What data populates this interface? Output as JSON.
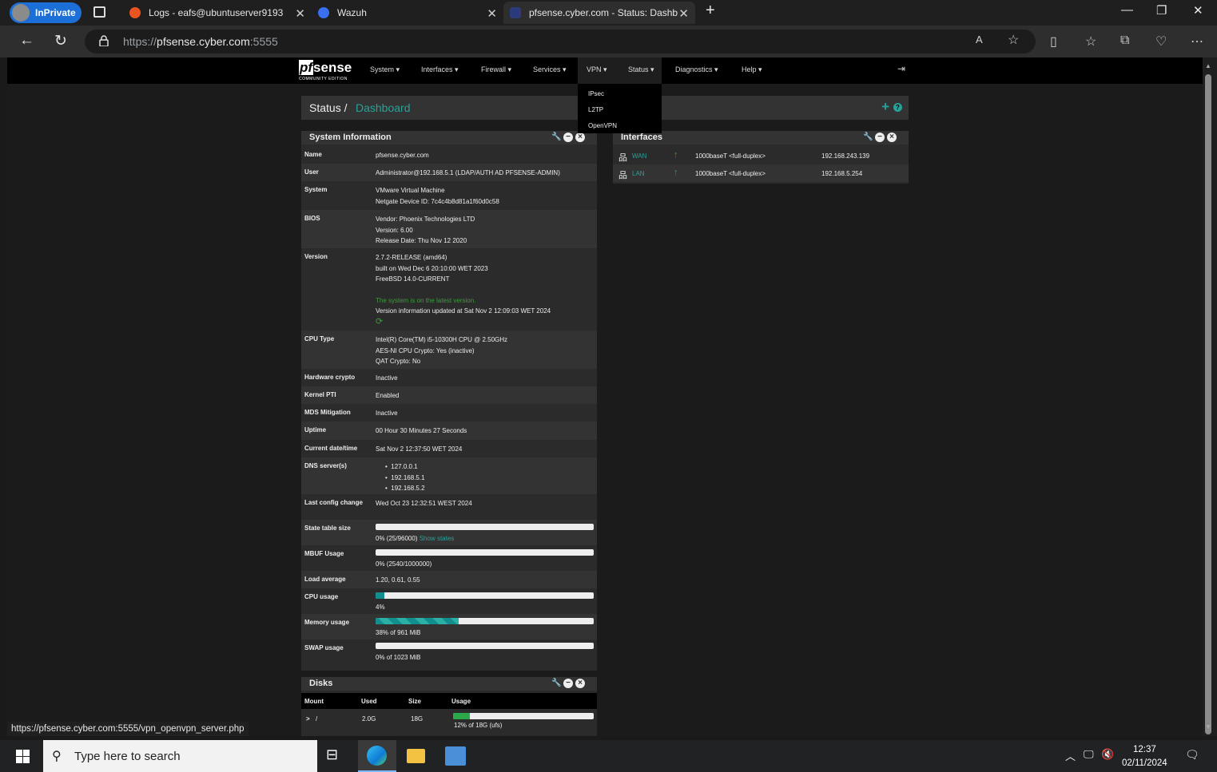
{
  "browser": {
    "inprivate": "InPrivate",
    "tabs": [
      {
        "title": "Logs - eafs@ubuntuserver9193"
      },
      {
        "title": "Wazuh"
      },
      {
        "title": "pfsense.cyber.com - Status: Dashb"
      }
    ],
    "url_scheme": "https://",
    "url_host": "pfsense.cyber.com",
    "url_port": ":5555",
    "status_url": "https://pfsense.cyber.com:5555/vpn_openvpn_server.php"
  },
  "pfsense": {
    "logo_pf": "pf",
    "logo_sense": "sense",
    "logo_edition": "COMMUNITY EDITION",
    "menu": [
      "System ▾",
      "Interfaces ▾",
      "Firewall ▾",
      "Services ▾",
      "VPN ▾",
      "Status ▾",
      "Diagnostics ▾",
      "Help ▾"
    ],
    "vpn_dropdown": [
      "IPsec",
      "L2TP",
      "OpenVPN"
    ],
    "breadcrumb_status": "Status /",
    "breadcrumb_page": "Dashboard"
  },
  "sysinfo": {
    "title": "System Information",
    "name_k": "Name",
    "name_v": "pfsense.cyber.com",
    "user_k": "User",
    "user_v": "Administrator@192.168.5.1 (LDAP/AUTH AD PFSENSE-ADMIN)",
    "system_k": "System",
    "system_v1": "VMware Virtual Machine",
    "system_v2": "Netgate Device ID: 7c4c4b8d81a1f60d0c58",
    "bios_k": "BIOS",
    "bios_v1": "Vendor: Phoenix Technologies LTD",
    "bios_v2": "Version: 6.00",
    "bios_v3": "Release Date: Thu Nov 12 2020",
    "version_k": "Version",
    "version_v1": "2.7.2-RELEASE (amd64)",
    "version_v2": "built on Wed Dec 6 20:10:00 WET 2023",
    "version_v3": "FreeBSD 14.0-CURRENT",
    "version_latest": "The system is on the latest version.",
    "version_updated": "Version information updated at Sat Nov 2 12:09:03 WET 2024",
    "cpu_k": "CPU Type",
    "cpu_v1": "Intel(R) Core(TM) i5-10300H CPU @ 2.50GHz",
    "cpu_v2": "AES-NI CPU Crypto: Yes (inactive)",
    "cpu_v3": "QAT Crypto: No",
    "hwcrypto_k": "Hardware crypto",
    "hwcrypto_v": "Inactive",
    "kpti_k": "Kernel PTI",
    "kpti_v": "Enabled",
    "mds_k": "MDS Mitigation",
    "mds_v": "Inactive",
    "uptime_k": "Uptime",
    "uptime_v": "00 Hour 30 Minutes 27 Seconds",
    "datetime_k": "Current date/time",
    "datetime_v": "Sat Nov 2 12:37:50 WET 2024",
    "dns_k": "DNS server(s)",
    "dns": [
      "127.0.0.1",
      "192.168.5.1",
      "192.168.5.2"
    ],
    "lastcfg_k": "Last config change",
    "lastcfg_v": "Wed Oct 23 12:32:51 WEST 2024",
    "state_k": "State table size",
    "state_v": "0% (25/96000)",
    "state_link": "Show states",
    "state_pct": 0,
    "mbuf_k": "MBUF Usage",
    "mbuf_v": "0% (2540/1000000)",
    "mbuf_pct": 0,
    "load_k": "Load average",
    "load_v": "1.20, 0.61, 0.55",
    "cpu_usage_k": "CPU usage",
    "cpu_usage_v": "4%",
    "cpu_pct": 4,
    "mem_k": "Memory usage",
    "mem_v": "38% of 961 MiB",
    "mem_pct": 38,
    "swap_k": "SWAP usage",
    "swap_v": "0% of 1023 MiB",
    "swap_pct": 0
  },
  "interfaces": {
    "title": "Interfaces",
    "rows": [
      {
        "name": "WAN",
        "media": "1000baseT <full-duplex>",
        "ip": "192.168.243.139"
      },
      {
        "name": "LAN",
        "media": "1000baseT <full-duplex>",
        "ip": "192.168.5.254"
      }
    ]
  },
  "disks": {
    "title": "Disks",
    "headers": [
      "Mount",
      "Used",
      "Size",
      "Usage"
    ],
    "row": {
      "mount": "/",
      "used": "2.0G",
      "size": "18G",
      "usage": "12% of 18G (ufs)",
      "pct": 12
    }
  },
  "taskbar": {
    "search_placeholder": "Type here to search",
    "time": "12:37",
    "date": "02/11/2024"
  },
  "colors": {
    "accent": "#2aa198",
    "link_green": "#3c9c3c"
  }
}
